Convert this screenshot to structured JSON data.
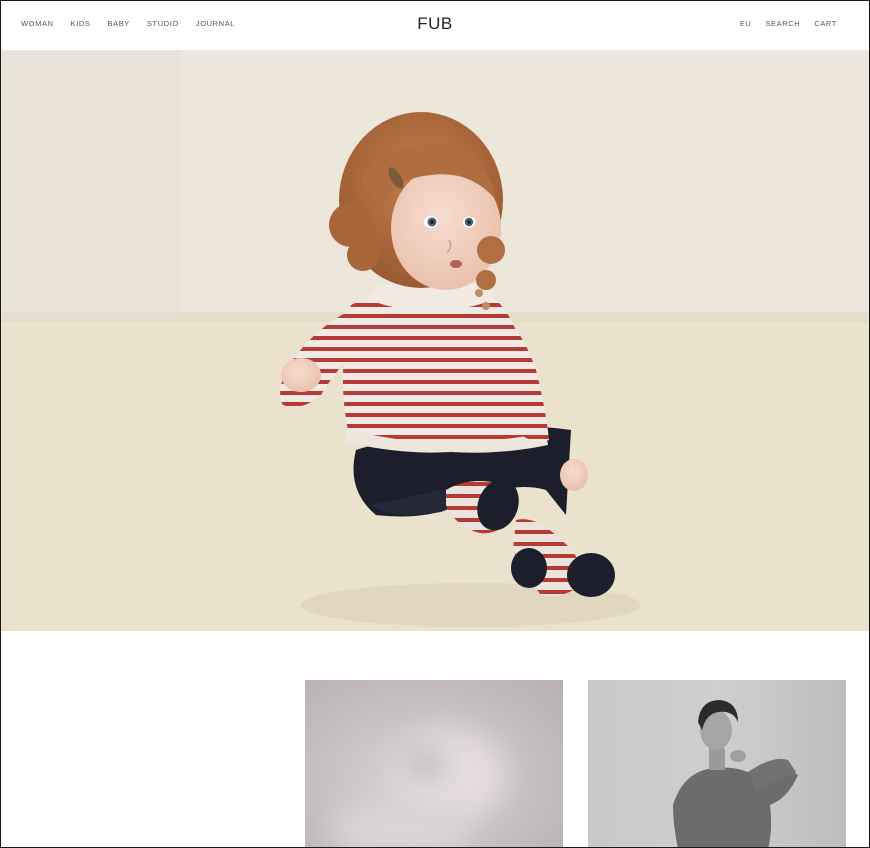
{
  "header": {
    "brand": "FUB",
    "nav_left": [
      "WOMAN",
      "KIDS",
      "BABY",
      "STUDIO",
      "JOURNAL"
    ],
    "nav_right": {
      "region": "EU",
      "search": "SEARCH",
      "cart": "CART"
    }
  },
  "colors": {
    "background": "#ffffff",
    "text": "#555555",
    "sweater_stripe": "#b83a35",
    "navy": "#1c1f2b"
  }
}
